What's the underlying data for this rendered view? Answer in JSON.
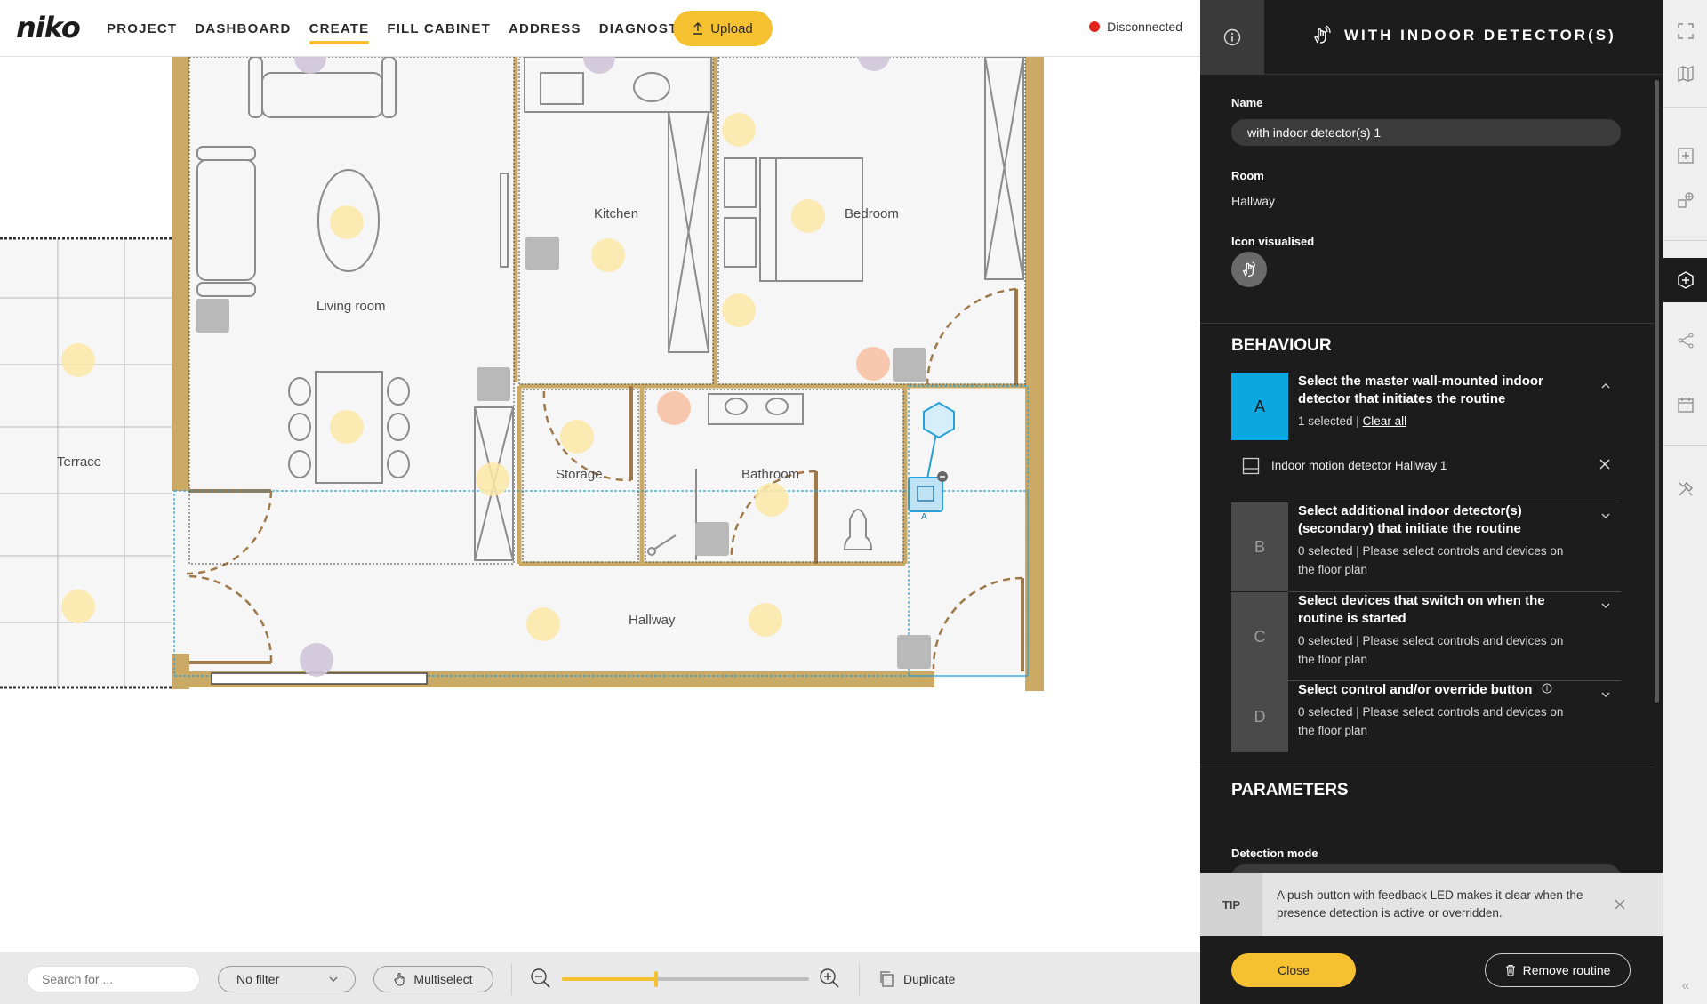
{
  "header": {
    "logo": "niko",
    "nav": [
      {
        "label": "PROJECT"
      },
      {
        "label": "DASHBOARD"
      },
      {
        "label": "CREATE",
        "active": true
      },
      {
        "label": "FILL CABINET"
      },
      {
        "label": "ADDRESS"
      },
      {
        "label": "DIAGNOSTICS",
        "external": true
      }
    ],
    "upload_label": "Upload",
    "status_label": "Disconnected",
    "status_color": "#e2231a"
  },
  "floorplan": {
    "rooms": [
      {
        "label": "Living room"
      },
      {
        "label": "Kitchen"
      },
      {
        "label": "Bedroom"
      },
      {
        "label": "Terrace"
      },
      {
        "label": "Storage"
      },
      {
        "label": "Bathroom"
      },
      {
        "label": "Hallway"
      }
    ],
    "selected_device_marker": "A"
  },
  "toolbar": {
    "search_placeholder": "Search for ...",
    "filter_label": "No filter",
    "multiselect_label": "Multiselect",
    "zoom_level": 0.38,
    "duplicate_label": "Duplicate"
  },
  "panel": {
    "title": "WITH INDOOR DETECTOR(S)",
    "name_label": "Name",
    "name_value": "with indoor detector(s) 1",
    "room_label": "Room",
    "room_value": "Hallway",
    "icon_label": "Icon visualised",
    "behaviour_title": "BEHAVIOUR",
    "steps": [
      {
        "letter": "A",
        "title": "Select the master wall-mounted indoor detector that initiates the routine",
        "selected_text": "1 selected | ",
        "clear_label": "Clear all",
        "expanded": true
      },
      {
        "letter": "B",
        "title": "Select additional indoor detector(s) (secondary) that initiate the routine",
        "sub": "0 selected | Please select controls and devices on the floor plan"
      },
      {
        "letter": "C",
        "title": "Select devices that switch on when the routine is started",
        "sub": "0 selected | Please select controls and devices on the floor plan"
      },
      {
        "letter": "D",
        "title": "Select control and/or override button",
        "sub": "0 selected | Please select controls and devices on the floor plan"
      }
    ],
    "selected_device": "Indoor motion detector Hallway 1",
    "parameters_title": "PARAMETERS",
    "detection_mode_label": "Detection mode",
    "tip_tag": "TIP",
    "tip_text": "A push button with feedback LED makes it clear when the presence detection is active or overridden.",
    "close_label": "Close",
    "remove_label": "Remove routine",
    "accent_color": "#0ba7e0",
    "yellow": "#f6c130"
  }
}
